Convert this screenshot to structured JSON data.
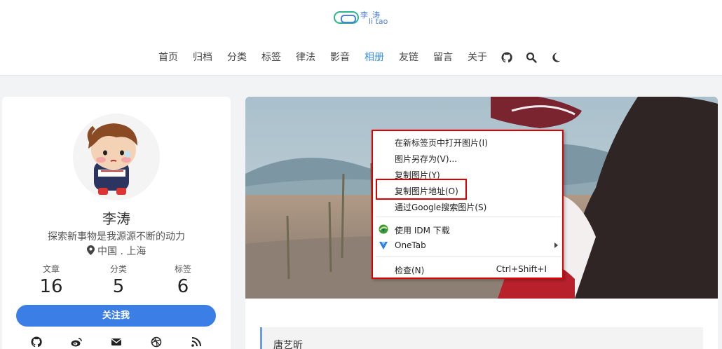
{
  "header": {
    "logo": {
      "line1": "李涛",
      "line2": "li tao"
    },
    "nav": [
      {
        "label": "首页"
      },
      {
        "label": "归档"
      },
      {
        "label": "分类"
      },
      {
        "label": "标签"
      },
      {
        "label": "律法"
      },
      {
        "label": "影音"
      },
      {
        "label": "相册",
        "active": true
      },
      {
        "label": "友链"
      },
      {
        "label": "留言"
      },
      {
        "label": "关于"
      }
    ],
    "nav_icons": [
      "github-icon",
      "search-icon",
      "moon-icon"
    ]
  },
  "profile": {
    "name": "李涛",
    "motto": "探索新事物是我源源不断的动力",
    "location": "中国 . 上海",
    "stats": [
      {
        "label": "文章",
        "value": "16"
      },
      {
        "label": "分类",
        "value": "5"
      },
      {
        "label": "标签",
        "value": "6"
      }
    ],
    "follow_label": "关注我",
    "social_icons": [
      "github-icon",
      "weibo-icon",
      "mail-icon",
      "dribbble-icon",
      "rss-icon"
    ]
  },
  "content": {
    "quote_text": "唐艺昕"
  },
  "context_menu": {
    "items": [
      {
        "label": "在新标签页中打开图片(I)"
      },
      {
        "label": "图片另存为(V)..."
      },
      {
        "label": "复制图片(Y)"
      },
      {
        "label": "复制图片地址(O)",
        "highlighted": true
      },
      {
        "label": "通过Google搜索图片(S)"
      },
      {
        "label": "使用 IDM 下载",
        "icon": "idm-icon"
      },
      {
        "label": "OneTab",
        "icon": "onetab-icon",
        "submenu": true
      },
      {
        "label": "检查(N)",
        "shortcut": "Ctrl+Shift+I"
      }
    ]
  },
  "colors": {
    "accent": "#3b7ee6",
    "active_nav": "#3b8ee9",
    "highlight_border": "#dd0000"
  }
}
